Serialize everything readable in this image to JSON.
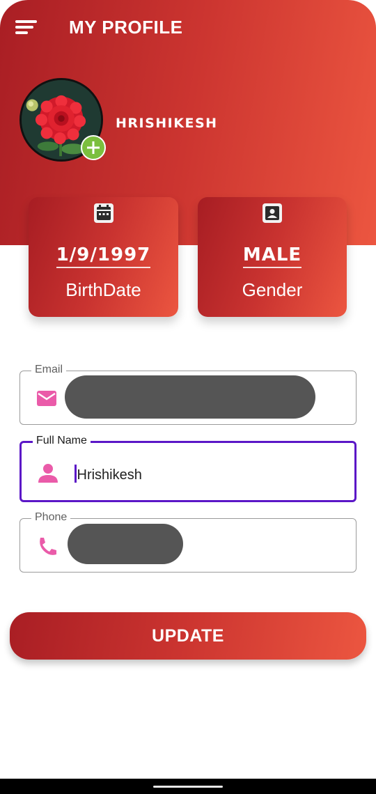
{
  "header": {
    "title": "MY PROFILE"
  },
  "profile": {
    "name": "HRISHIKESH"
  },
  "cards": {
    "birthdate": {
      "value": "1/9/1997",
      "label": "BirthDate",
      "icon": "calendar-icon"
    },
    "gender": {
      "value": "MALE",
      "label": "Gender",
      "icon": "contact-card-icon"
    }
  },
  "form": {
    "email": {
      "label": "Email",
      "value": "",
      "icon": "email-icon",
      "redacted": true
    },
    "full_name": {
      "label": "Full Name",
      "value": "Hrishikesh",
      "icon": "person-icon",
      "focused": true
    },
    "phone": {
      "label": "Phone",
      "value": "",
      "icon": "phone-icon",
      "redacted": true
    }
  },
  "actions": {
    "update_label": "UPDATE"
  },
  "colors": {
    "gradient_start": "#a91e24",
    "gradient_end": "#ec5640",
    "accent_focus": "#5b17c7",
    "icon_pink": "#ea5ba9",
    "add_badge": "#7bbf3e"
  }
}
